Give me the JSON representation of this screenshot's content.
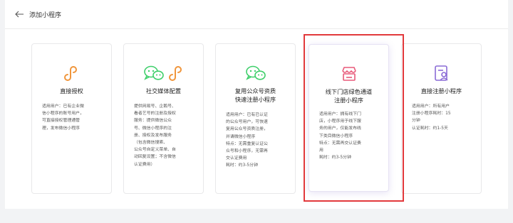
{
  "header": {
    "title": "添加小程序"
  },
  "icons": {
    "back": "arrow-left-icon"
  },
  "colors": {
    "accent": "#f0963c",
    "green": "#3ecf6a",
    "pink": "#e85a7a",
    "purple": "#8a6bd6",
    "highlight": "#e2393c"
  },
  "cards": [
    {
      "title": "直接授权",
      "desc": "适用用户：已有企业微\n信小程序的账号用户，\n可直接授权管理通管\n理，发布微信小程序"
    },
    {
      "title": "社交媒体配置",
      "desc": "提供网易号、企鹅号、\n看者艺号的注册及授权\n服务：提供微信公众\n号、微信小程序的注\n册、授权及发布服务\n（包含微信搜索、\n公众号自定义菜单、自\n动回复设置；不含微信\n认证费用）"
    },
    {
      "title": "复用公众号资质\n快速注册小程序",
      "desc": "适用用户：已有已认证\n的公众号用户，可快速\n复用公众号资质注册，\n并请微信小程序\n特点：无需重复认证公\n众号和小程序，无需再\n交认证费用\n耗时：约3-5分钟"
    },
    {
      "title": "线下门店绿色通道\n注册小程序",
      "desc": "适用用户：拥有线下门\n店，小程序用于线下服\n务的用户，仅能发布线\n下类目微信小程序\n特点：无需再交认证费\n用\n耗时：约3-5分钟"
    },
    {
      "title": "直接注册小程序",
      "desc": "适用用户：所有用户\n注册小程序耗时：15\n分钟\n认证耗时：约1-5天"
    }
  ]
}
